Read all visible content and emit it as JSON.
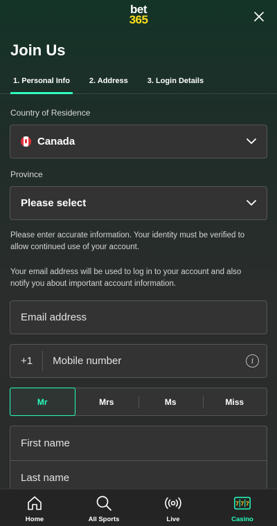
{
  "header": {
    "logo_line1": "bet",
    "logo_line2": "365",
    "page_title": "Join Us"
  },
  "tabs": [
    {
      "label": "1.  Personal Info",
      "active": true
    },
    {
      "label": "2.  Address",
      "active": false
    },
    {
      "label": "3.  Login Details",
      "active": false
    }
  ],
  "form": {
    "country_label": "Country of Residence",
    "country_value": "Canada",
    "province_label": "Province",
    "province_value": "Please select",
    "info_text_1": "Please enter accurate information. Your identity must be verified to allow continued use of your account.",
    "info_text_2": "Your email address will be used to log in to your account and also notify you about important account information.",
    "email_placeholder": "Email address",
    "phone_prefix": "+1",
    "mobile_placeholder": "Mobile number",
    "titles": [
      "Mr",
      "Mrs",
      "Ms",
      "Miss"
    ],
    "selected_title": "Mr",
    "first_name_placeholder": "First name",
    "last_name_placeholder": "Last name"
  },
  "bottom_nav": [
    {
      "label": "Home",
      "icon": "home-icon"
    },
    {
      "label": "All Sports",
      "icon": "search-icon"
    },
    {
      "label": "Live",
      "icon": "live-broadcast-icon"
    },
    {
      "label": "Casino",
      "icon": "slot-machine-icon"
    }
  ],
  "colors": {
    "accent": "#26ffbe",
    "logo_yellow": "#ffdf1b",
    "field_bg": "#333333"
  }
}
